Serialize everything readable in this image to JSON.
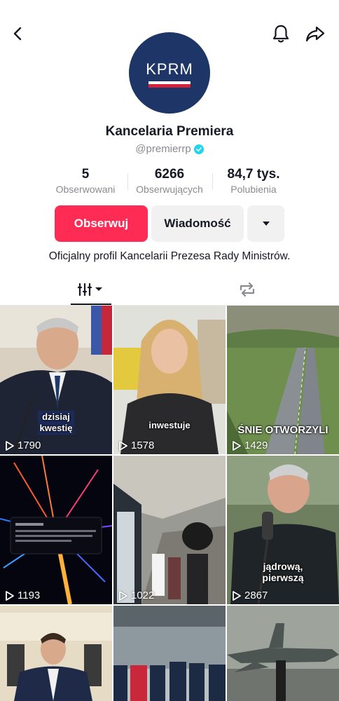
{
  "profile": {
    "avatar_text": "KPRM",
    "display_name": "Kancelaria Premiera",
    "username": "@premierrp",
    "bio": "Oficjalny profil Kancelarii Prezesa Rady Ministrów."
  },
  "stats": {
    "following": {
      "value": "5",
      "label": "Obserwowani"
    },
    "followers": {
      "value": "6266",
      "label": "Obserwujących"
    },
    "likes": {
      "value": "84,7 tys.",
      "label": "Polubienia"
    }
  },
  "actions": {
    "follow_label": "Obserwuj",
    "message_label": "Wiadomość"
  },
  "colors": {
    "accent": "#fe2c55",
    "avatar_bg": "#1e3567",
    "verified": "#20d5ec"
  },
  "icons": {
    "back": "chevron-left-icon",
    "bell": "bell-icon",
    "share": "share-arrow-icon",
    "more": "caret-down-icon",
    "videos_tab": "grid-bars-icon",
    "reposts_tab": "repost-icon",
    "play": "play-icon"
  },
  "videos": [
    {
      "caption": "dzisiaj\nkwestię",
      "views": "1790"
    },
    {
      "caption": "inwestuje",
      "views": "1578"
    },
    {
      "caption": "ŚNIE OTWORZYLI",
      "views": "1429"
    },
    {
      "caption": "",
      "views": "1193"
    },
    {
      "caption": "",
      "views": "1022"
    },
    {
      "caption": "jądrową,\npierwszą",
      "views": "2867"
    },
    {
      "caption": "",
      "views": ""
    },
    {
      "caption": "",
      "views": ""
    },
    {
      "caption": "",
      "views": ""
    }
  ]
}
